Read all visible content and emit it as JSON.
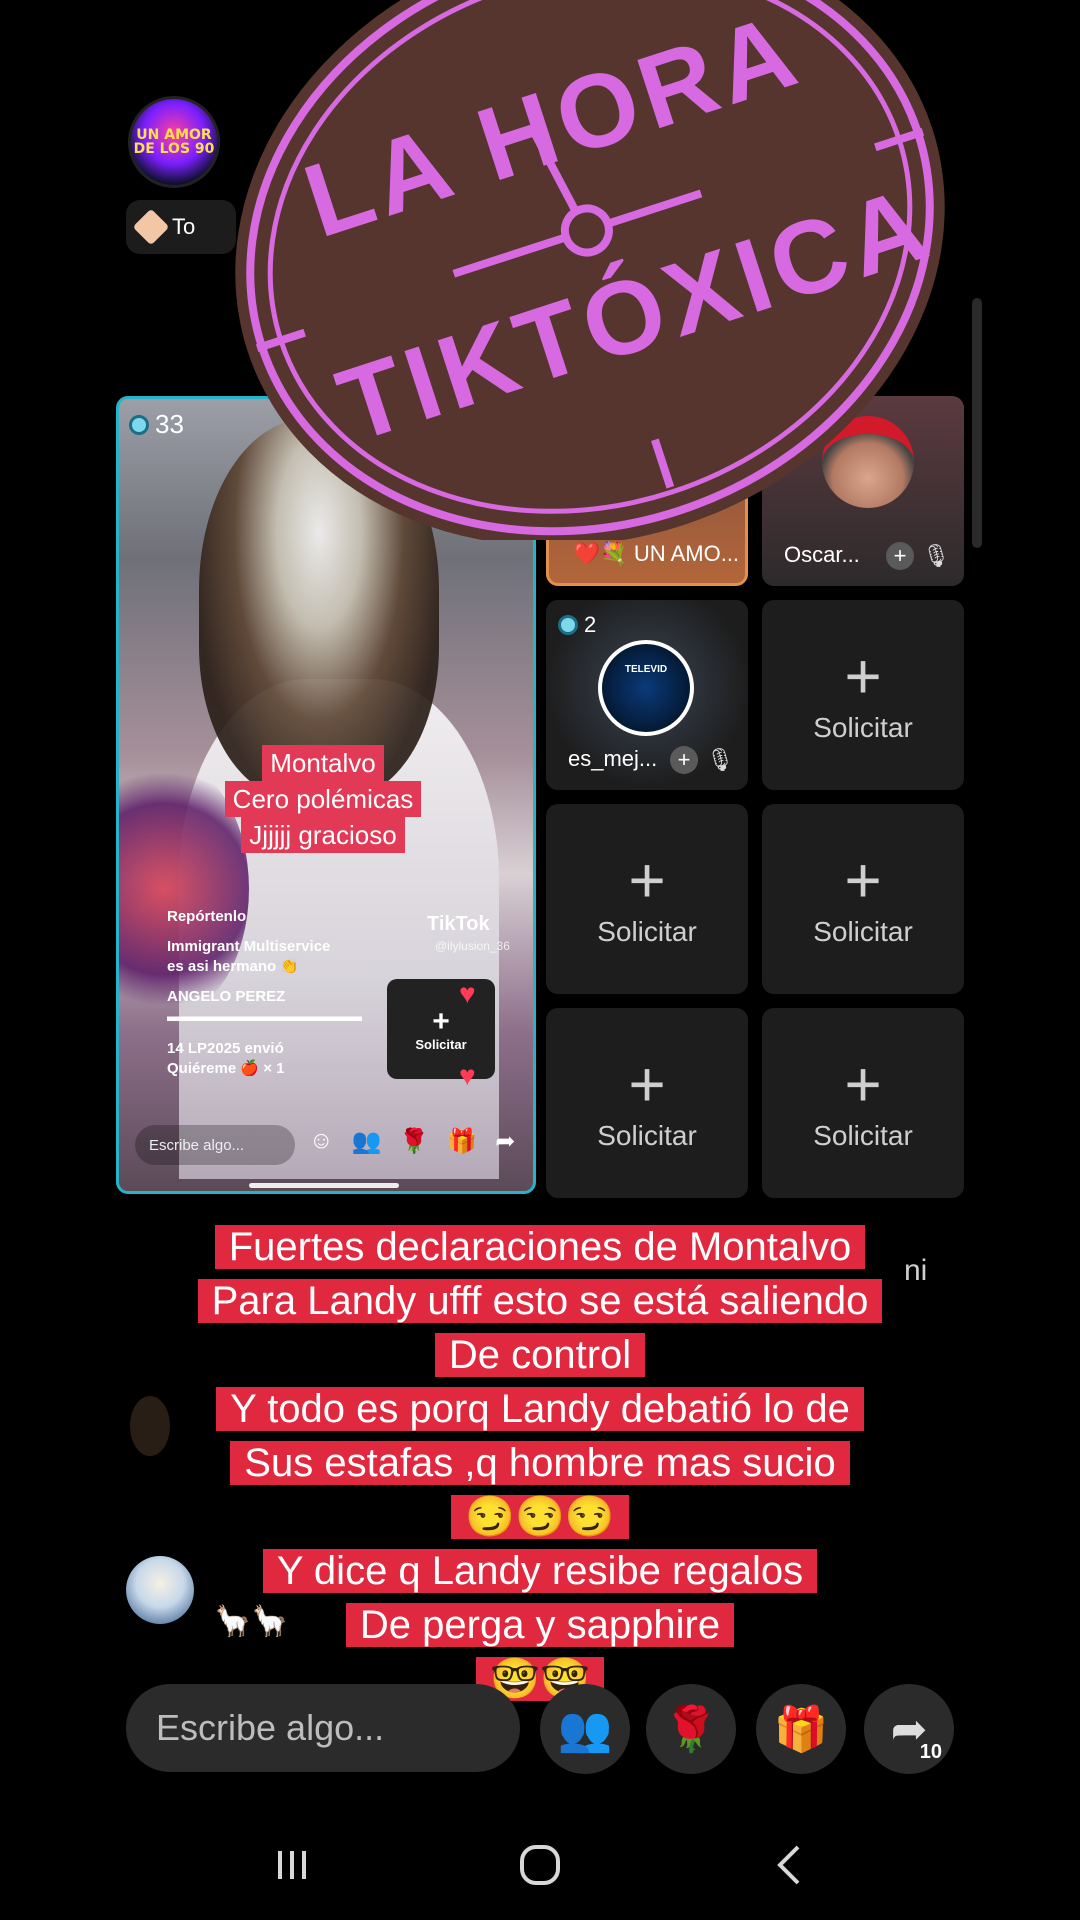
{
  "host": {
    "avatar_text": "UN AMOR DE LOS 90",
    "top_pill_label": "To"
  },
  "main_video": {
    "viewer_count": "33",
    "caption_lines": [
      "Montalvo",
      "Cero polémicas",
      "Jjjjjj  gracioso"
    ],
    "tiktok_mark": "TikTok",
    "tiktok_handle": "@ilylusion_36",
    "comments": [
      {
        "user": "Repórtenlo",
        "text": ""
      },
      {
        "user": "Immigrant Multiservice",
        "text": "es asi hermano 👏"
      },
      {
        "user": "ANGELO PEREZ",
        "text": "▬▬▬▬▬▬▬▬▬▬▬▬▬"
      },
      {
        "user": "14  LP2025 envió",
        "text": "Quiéreme 🍎 × 1"
      }
    ],
    "inner_request_label": "Solicitar",
    "inner_input_placeholder": "Escribe algo..."
  },
  "grid": {
    "tiles": [
      {
        "name": "UN AMO...",
        "prefix": "❤️💐"
      },
      {
        "name": "Oscar..."
      },
      {
        "name": "es_mej...",
        "viewer_count": "2",
        "avatar_text": "TELEVID"
      }
    ],
    "request_label": "Solicitar"
  },
  "stamp": {
    "top_text": "LA HORA",
    "bottom_text": "TIKTÓXICA",
    "color": "#d76ae0",
    "fill": "#56352f"
  },
  "overlay_caption": {
    "lines": [
      "Fuertes declaraciones de Montalvo",
      "Para Landy ufff esto se está saliendo",
      "De control",
      "Y todo es porq Landy debatió lo de",
      "Sus estafas ,q hombre mas sucio",
      "😏😏😏",
      "Y dice q Landy resibe regalos",
      "De perga y sapphire",
      "🤓🤓"
    ],
    "background": "#e0283f"
  },
  "chat": {
    "partial_text": "ni",
    "emojis": "🦙🦙"
  },
  "bottom_bar": {
    "input_placeholder": "Escribe algo...",
    "share_count": "10",
    "icons": [
      "people-icon",
      "rose-icon",
      "gift-icon",
      "share-icon"
    ]
  },
  "nav": {
    "icons": [
      "recents-icon",
      "home-icon",
      "back-icon"
    ]
  }
}
